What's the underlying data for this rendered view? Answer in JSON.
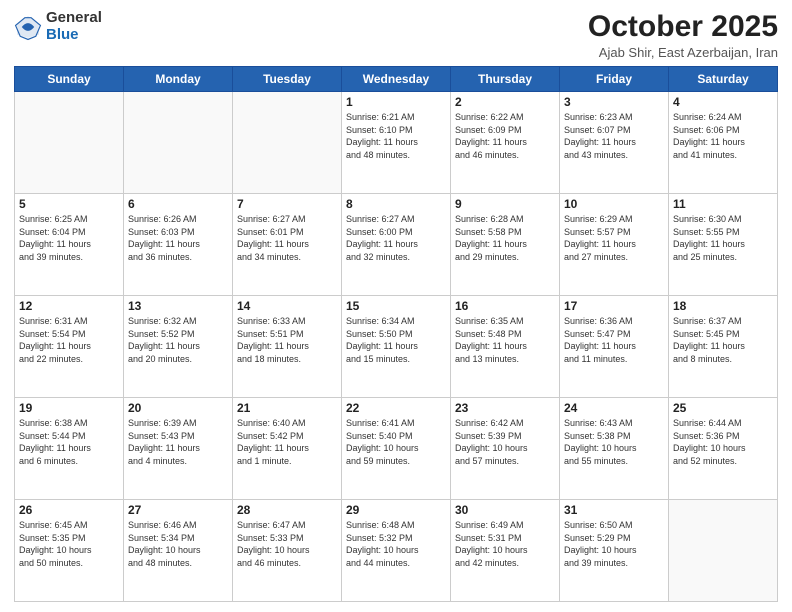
{
  "header": {
    "logo_general": "General",
    "logo_blue": "Blue",
    "month_title": "October 2025",
    "location": "Ajab Shir, East Azerbaijan, Iran"
  },
  "weekdays": [
    "Sunday",
    "Monday",
    "Tuesday",
    "Wednesday",
    "Thursday",
    "Friday",
    "Saturday"
  ],
  "weeks": [
    [
      {
        "day": "",
        "info": ""
      },
      {
        "day": "",
        "info": ""
      },
      {
        "day": "",
        "info": ""
      },
      {
        "day": "1",
        "info": "Sunrise: 6:21 AM\nSunset: 6:10 PM\nDaylight: 11 hours\nand 48 minutes."
      },
      {
        "day": "2",
        "info": "Sunrise: 6:22 AM\nSunset: 6:09 PM\nDaylight: 11 hours\nand 46 minutes."
      },
      {
        "day": "3",
        "info": "Sunrise: 6:23 AM\nSunset: 6:07 PM\nDaylight: 11 hours\nand 43 minutes."
      },
      {
        "day": "4",
        "info": "Sunrise: 6:24 AM\nSunset: 6:06 PM\nDaylight: 11 hours\nand 41 minutes."
      }
    ],
    [
      {
        "day": "5",
        "info": "Sunrise: 6:25 AM\nSunset: 6:04 PM\nDaylight: 11 hours\nand 39 minutes."
      },
      {
        "day": "6",
        "info": "Sunrise: 6:26 AM\nSunset: 6:03 PM\nDaylight: 11 hours\nand 36 minutes."
      },
      {
        "day": "7",
        "info": "Sunrise: 6:27 AM\nSunset: 6:01 PM\nDaylight: 11 hours\nand 34 minutes."
      },
      {
        "day": "8",
        "info": "Sunrise: 6:27 AM\nSunset: 6:00 PM\nDaylight: 11 hours\nand 32 minutes."
      },
      {
        "day": "9",
        "info": "Sunrise: 6:28 AM\nSunset: 5:58 PM\nDaylight: 11 hours\nand 29 minutes."
      },
      {
        "day": "10",
        "info": "Sunrise: 6:29 AM\nSunset: 5:57 PM\nDaylight: 11 hours\nand 27 minutes."
      },
      {
        "day": "11",
        "info": "Sunrise: 6:30 AM\nSunset: 5:55 PM\nDaylight: 11 hours\nand 25 minutes."
      }
    ],
    [
      {
        "day": "12",
        "info": "Sunrise: 6:31 AM\nSunset: 5:54 PM\nDaylight: 11 hours\nand 22 minutes."
      },
      {
        "day": "13",
        "info": "Sunrise: 6:32 AM\nSunset: 5:52 PM\nDaylight: 11 hours\nand 20 minutes."
      },
      {
        "day": "14",
        "info": "Sunrise: 6:33 AM\nSunset: 5:51 PM\nDaylight: 11 hours\nand 18 minutes."
      },
      {
        "day": "15",
        "info": "Sunrise: 6:34 AM\nSunset: 5:50 PM\nDaylight: 11 hours\nand 15 minutes."
      },
      {
        "day": "16",
        "info": "Sunrise: 6:35 AM\nSunset: 5:48 PM\nDaylight: 11 hours\nand 13 minutes."
      },
      {
        "day": "17",
        "info": "Sunrise: 6:36 AM\nSunset: 5:47 PM\nDaylight: 11 hours\nand 11 minutes."
      },
      {
        "day": "18",
        "info": "Sunrise: 6:37 AM\nSunset: 5:45 PM\nDaylight: 11 hours\nand 8 minutes."
      }
    ],
    [
      {
        "day": "19",
        "info": "Sunrise: 6:38 AM\nSunset: 5:44 PM\nDaylight: 11 hours\nand 6 minutes."
      },
      {
        "day": "20",
        "info": "Sunrise: 6:39 AM\nSunset: 5:43 PM\nDaylight: 11 hours\nand 4 minutes."
      },
      {
        "day": "21",
        "info": "Sunrise: 6:40 AM\nSunset: 5:42 PM\nDaylight: 11 hours\nand 1 minute."
      },
      {
        "day": "22",
        "info": "Sunrise: 6:41 AM\nSunset: 5:40 PM\nDaylight: 10 hours\nand 59 minutes."
      },
      {
        "day": "23",
        "info": "Sunrise: 6:42 AM\nSunset: 5:39 PM\nDaylight: 10 hours\nand 57 minutes."
      },
      {
        "day": "24",
        "info": "Sunrise: 6:43 AM\nSunset: 5:38 PM\nDaylight: 10 hours\nand 55 minutes."
      },
      {
        "day": "25",
        "info": "Sunrise: 6:44 AM\nSunset: 5:36 PM\nDaylight: 10 hours\nand 52 minutes."
      }
    ],
    [
      {
        "day": "26",
        "info": "Sunrise: 6:45 AM\nSunset: 5:35 PM\nDaylight: 10 hours\nand 50 minutes."
      },
      {
        "day": "27",
        "info": "Sunrise: 6:46 AM\nSunset: 5:34 PM\nDaylight: 10 hours\nand 48 minutes."
      },
      {
        "day": "28",
        "info": "Sunrise: 6:47 AM\nSunset: 5:33 PM\nDaylight: 10 hours\nand 46 minutes."
      },
      {
        "day": "29",
        "info": "Sunrise: 6:48 AM\nSunset: 5:32 PM\nDaylight: 10 hours\nand 44 minutes."
      },
      {
        "day": "30",
        "info": "Sunrise: 6:49 AM\nSunset: 5:31 PM\nDaylight: 10 hours\nand 42 minutes."
      },
      {
        "day": "31",
        "info": "Sunrise: 6:50 AM\nSunset: 5:29 PM\nDaylight: 10 hours\nand 39 minutes."
      },
      {
        "day": "",
        "info": ""
      }
    ]
  ]
}
